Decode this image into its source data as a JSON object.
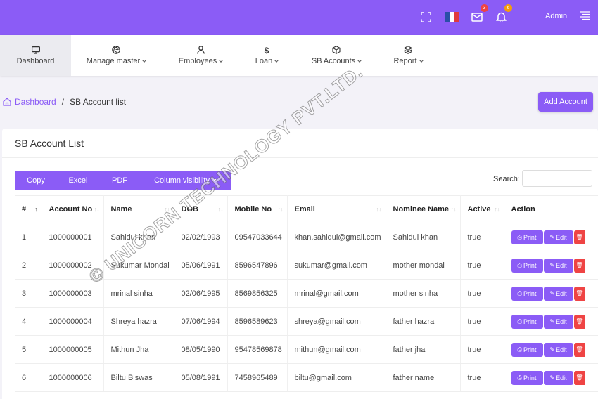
{
  "header": {
    "admin_label": "Admin",
    "mail_count": "3",
    "bell_count": "6",
    "colors": {
      "primary": "#8b5cf6",
      "danger": "#ef4444",
      "mail_badge": "#ef4444",
      "bell_badge": "#f59e0b"
    }
  },
  "nav": {
    "items": [
      {
        "label": "Dashboard",
        "icon": "monitor-icon"
      },
      {
        "label": "Manage master",
        "icon": "aperture-icon"
      },
      {
        "label": "Employees",
        "icon": "user-icon"
      },
      {
        "label": "Loan",
        "icon": "dollar-icon"
      },
      {
        "label": "SB Accounts",
        "icon": "box-icon"
      },
      {
        "label": "Report",
        "icon": "layers-icon"
      }
    ]
  },
  "breadcrumb": {
    "home": "Dashboard",
    "separator": "/",
    "current": "SB Account list"
  },
  "add_button": "Add Account",
  "card": {
    "title": "SB Account List",
    "buttons": [
      "Copy",
      "Excel",
      "PDF",
      "Column visibility"
    ],
    "search_label": "Search:",
    "search_value": ""
  },
  "table": {
    "headers": [
      "#",
      "Account No",
      "Name",
      "DOB",
      "Mobile No",
      "Email",
      "Nominee Name",
      "Active",
      "Action"
    ],
    "rows": [
      [
        "1",
        "1000000001",
        "Sahidul khan",
        "02/02/1993",
        "09547033644",
        "khan.sahidul@gmail.com",
        "Sahidul khan",
        "true"
      ],
      [
        "2",
        "1000000002",
        "Sukumar Mondal",
        "05/06/1991",
        "8596547896",
        "sukumar@gmail.com",
        "mother mondal",
        "true"
      ],
      [
        "3",
        "1000000003",
        "mrinal sinha",
        "02/06/1995",
        "8569856325",
        "mrinal@gmail.com",
        "mother sinha",
        "true"
      ],
      [
        "4",
        "1000000004",
        "Shreya hazra",
        "07/06/1994",
        "8596589623",
        "shreya@gmail.com",
        "father hazra",
        "true"
      ],
      [
        "5",
        "1000000005",
        "Mithun Jha",
        "08/05/1990",
        "95478569878",
        "mithun@gmail.com",
        "father jha",
        "true"
      ],
      [
        "6",
        "1000000006",
        "Biltu Biswas",
        "05/08/1991",
        "7458965489",
        "biltu@gmail.com",
        "father name",
        "true"
      ]
    ],
    "action_print": "Print",
    "action_edit": "Edit"
  },
  "watermark": "© UNICORN TECHNOLOGY PVT.LTD."
}
